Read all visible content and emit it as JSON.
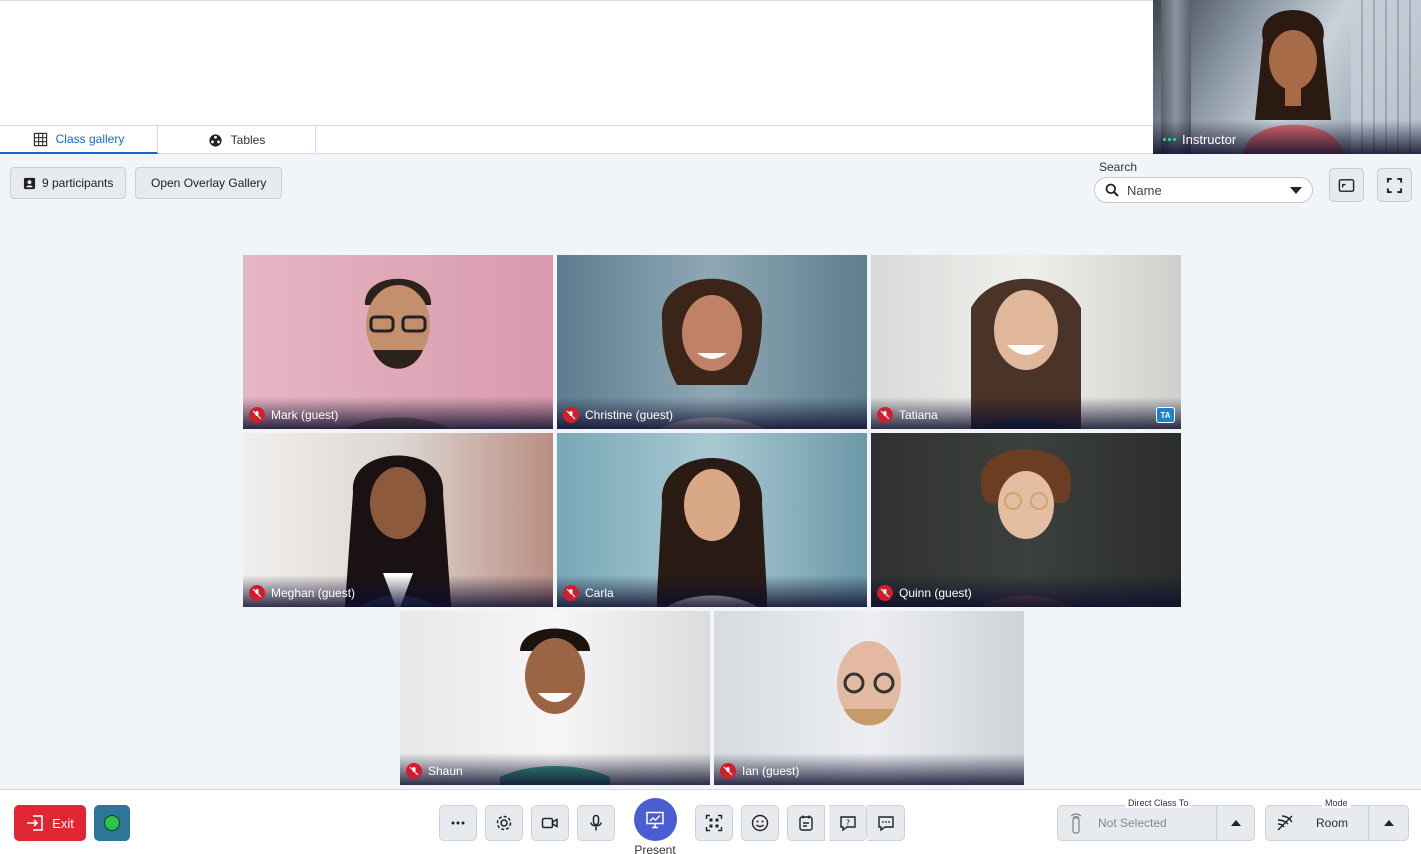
{
  "instructor": {
    "name": "Instructor"
  },
  "tabs": [
    {
      "label": "Class gallery",
      "icon": "grid-icon",
      "active": true
    },
    {
      "label": "Tables",
      "icon": "tables-icon",
      "active": false
    }
  ],
  "toolbar": {
    "participants_label": "9 participants",
    "overlay_label": "Open Overlay Gallery"
  },
  "search": {
    "label": "Search",
    "value": "Name"
  },
  "participants": [
    {
      "name": "Mark (guest)",
      "muted": true,
      "badge": ""
    },
    {
      "name": "Christine (guest)",
      "muted": true,
      "badge": ""
    },
    {
      "name": "Tatiana",
      "muted": true,
      "badge": "TA"
    },
    {
      "name": "Meghan (guest)",
      "muted": true,
      "badge": ""
    },
    {
      "name": "Carla",
      "muted": true,
      "badge": ""
    },
    {
      "name": "Quinn (guest)",
      "muted": true,
      "badge": ""
    },
    {
      "name": "Shaun",
      "muted": true,
      "badge": ""
    },
    {
      "name": "Ian (guest)",
      "muted": true,
      "badge": ""
    }
  ],
  "bottom": {
    "exit_label": "Exit",
    "present_label": "Present",
    "direct_class": {
      "legend": "Direct Class To",
      "value": "Not Selected"
    },
    "mode": {
      "legend": "Mode",
      "value": "Room"
    }
  },
  "colors": {
    "accent": "#1769c7",
    "exit": "#e02534",
    "present": "#4a5ed1",
    "muted": "#d21d2c",
    "status": "#2dc34c"
  }
}
